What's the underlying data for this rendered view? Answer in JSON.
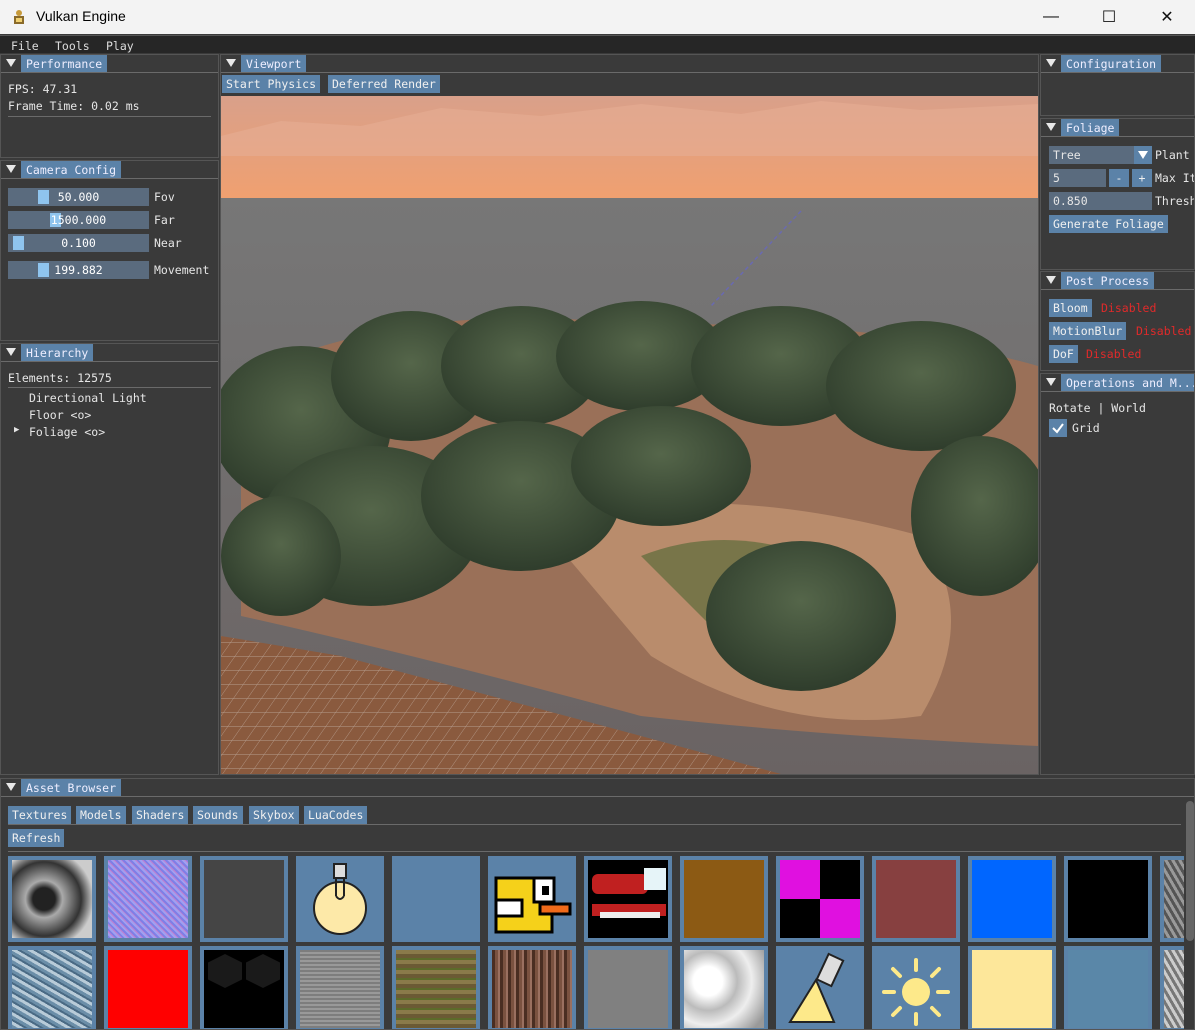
{
  "window": {
    "title": "Vulkan Engine",
    "minimize_glyph": "—",
    "maximize_glyph": "☐",
    "close_glyph": "✕"
  },
  "menu": {
    "items": [
      "File",
      "Tools",
      "Play"
    ]
  },
  "performance": {
    "title": "Performance",
    "fps": "FPS: 47.31",
    "frame_time": "Frame Time: 0.02 ms"
  },
  "camera": {
    "title": "Camera Config",
    "sliders": [
      {
        "value": "50.000",
        "label": "Fov",
        "fraction": 0.22
      },
      {
        "value": "1500.000",
        "label": "Far",
        "fraction": 0.32
      },
      {
        "value": "0.100",
        "label": "Near",
        "fraction": 0.02
      },
      {
        "value": "199.882",
        "label": "Movement",
        "fraction": 0.22
      }
    ]
  },
  "hierarchy": {
    "title": "Hierarchy",
    "elements": "Elements: 12575",
    "items": [
      "Directional Light",
      "Floor <o>",
      "Foliage <o>"
    ],
    "expand_glyph": "▶"
  },
  "viewport": {
    "title": "Viewport",
    "buttons": [
      "Start Physics",
      "Deferred Render"
    ]
  },
  "configuration": {
    "title": "Configuration"
  },
  "foliage": {
    "title": "Foliage",
    "type_value": "Tree",
    "type_label": "Plant",
    "iter_value": "5",
    "iter_label": "Max It",
    "minus": "-",
    "plus": "+",
    "threshold_value": "0.850",
    "threshold_label": "Thresh",
    "generate_button": "Generate Foliage"
  },
  "post_process": {
    "title": "Post Process",
    "effects": [
      {
        "name": "Bloom",
        "status": "Disabled"
      },
      {
        "name": "MotionBlur",
        "status": "Disabled"
      },
      {
        "name": "DoF",
        "status": "Disabled"
      }
    ]
  },
  "operations": {
    "title": "Operations and M...",
    "mode": "Rotate | World",
    "grid_label": "Grid",
    "grid_checked": true
  },
  "assets": {
    "title": "Asset Browser",
    "tabs": [
      "Textures",
      "Models",
      "Shaders",
      "Sounds",
      "Skybox",
      "LuaCodes"
    ],
    "refresh": "Refresh"
  },
  "colors": {
    "accent": "#5b82a8",
    "disabled_text": "#e02a2a",
    "panel_bg": "#3a3a3a",
    "sky": "#e8a27c"
  }
}
